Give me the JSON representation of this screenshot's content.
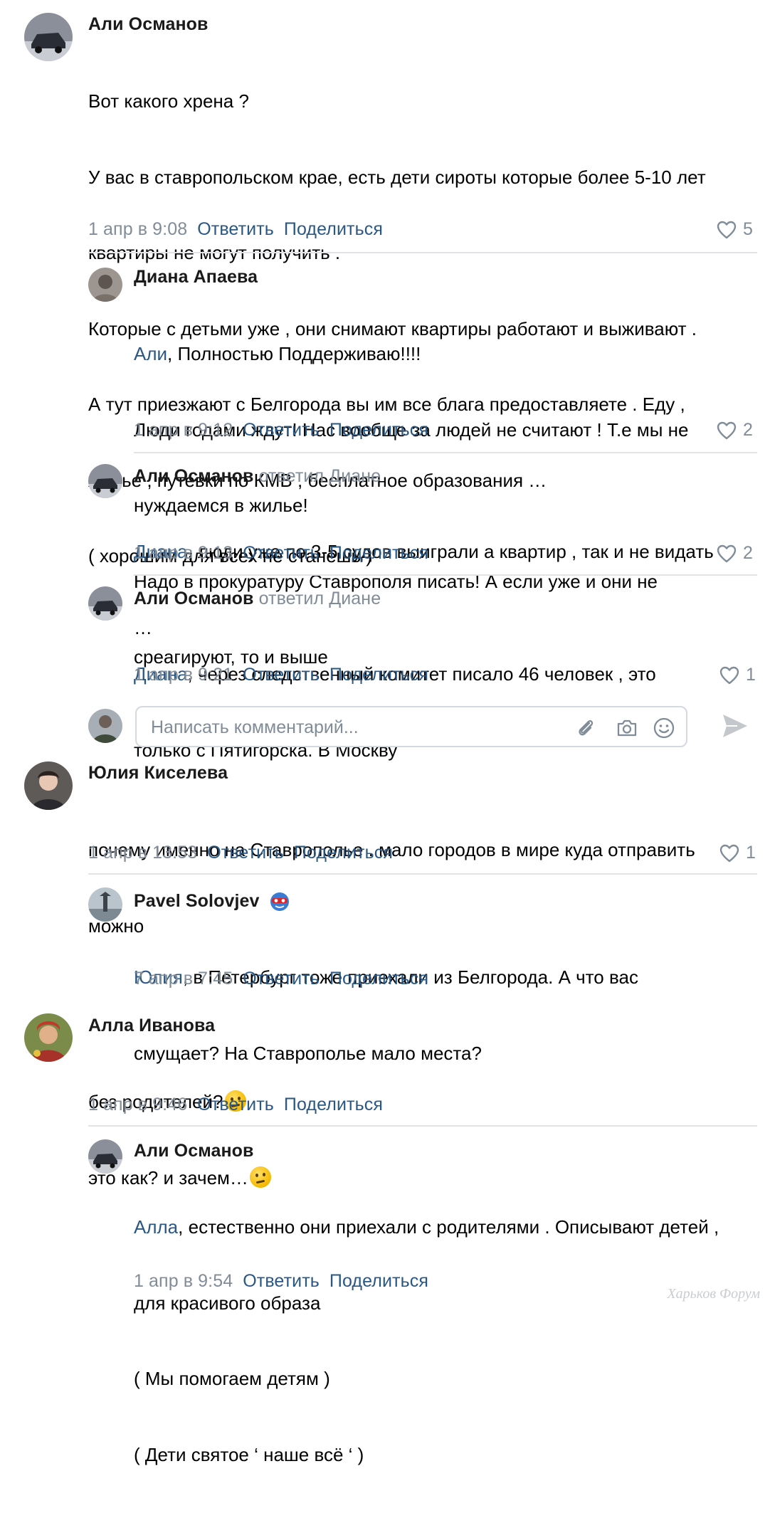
{
  "colors": {
    "link": "#2a5885",
    "meta": "#818c99",
    "separator": "#e1e3e6"
  },
  "comments": [
    {
      "author": "Али Османов",
      "lines": [
        "Вот какого хрена ?",
        "У вас в ставропольском крае, есть дети сироты которые более 5-10 лет",
        "квартиры не могут получить .",
        "Которые с детьми уже , они снимают квартиры работают и выживают .",
        "А тут приезжают с Белгорода вы им все блага предоставляете . Еду ,",
        "жилье , путевки по КМВ , бесплатное образования …",
        "( хорошим для всех не станешь )"
      ],
      "date": "1 апр в 9:08",
      "reply": "Ответить",
      "share": "Поделиться",
      "likes": "5"
    },
    {
      "author": "Диана Апаева",
      "mention": "Али",
      "first_line_rest": ", Полностью Поддерживаю!!!!",
      "lines": [
        "Люди годами ждут! Нас вообще за людей не считают ! Т.е мы не",
        "нуждаемся в жилье!",
        "Надо в прокуратуру Ставрополя писать! А если уже и они не",
        "среагируют, то и выше"
      ],
      "date": "1 апр в 9:12",
      "reply": "Ответить",
      "share": "Поделиться",
      "likes": "2"
    },
    {
      "author": "Али Османов",
      "replied_to": "ответил Диане",
      "mention": "Диана",
      "first_line_rest": ", люди уже по 3-5 судов выиграли а квартир , так и не видать",
      "lines": [
        "…"
      ],
      "date": "1 апр в 9:13",
      "reply": "Ответить",
      "share": "Поделиться",
      "likes": "2"
    },
    {
      "author": "Али Османов",
      "replied_to": "ответил Диане",
      "mention": "Диана",
      "first_line_rest": ", через следственный комитет писало 46 человек , это",
      "lines": [
        "только с Пятигорска. В Москву"
      ],
      "date": "1 апр в 9:21",
      "reply": "Ответить",
      "share": "Поделиться",
      "likes": "1"
    },
    {
      "author": "Юлия Киселева",
      "lines": [
        "почему именно на Ставрополье . мало городов в мире куда отправить",
        "можно"
      ],
      "date": "1 апр в 13:53",
      "reply": "Ответить",
      "share": "Поделиться",
      "likes": "1"
    },
    {
      "author": "Pavel Solovjev",
      "mention": "Юлия",
      "first_line_rest": ", в Петербург тоже приехали из Белгорода. А что вас",
      "lines": [
        "смущает? На Ставрополье мало места?"
      ],
      "date": "7 апр в 7:45",
      "reply": "Ответить",
      "share": "Поделиться"
    },
    {
      "author": "Алла Иванова",
      "lines": [
        "без родителей?",
        "это как? и зачем…"
      ],
      "date": "1 апр в 9:46",
      "reply": "Ответить",
      "share": "Поделиться"
    },
    {
      "author": "Али Османов",
      "mention": "Алла",
      "first_line_rest": ", естественно они приехали с родителями . Описывают детей ,",
      "lines": [
        "для красивого образа",
        "( Мы помогаем детям )",
        "( Дети святое ‘ наше всё ‘ )"
      ],
      "date": "1 апр в 9:54",
      "reply": "Ответить",
      "share": "Поделиться"
    }
  ],
  "composer": {
    "placeholder": "Написать комментарий..."
  },
  "watermark": "Харьков Форум"
}
